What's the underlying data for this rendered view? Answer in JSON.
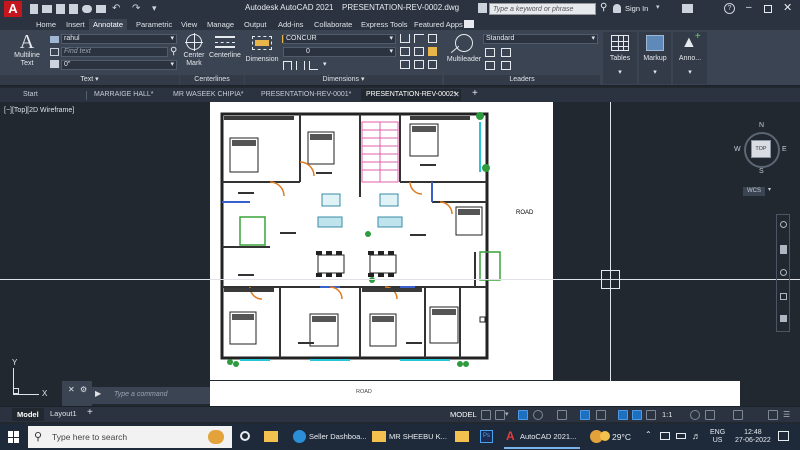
{
  "titlebar": {
    "app_title": "Autodesk AutoCAD 2021",
    "file_name": "PRESENTATION-REV-0002.dwg",
    "search_placeholder": "Type a keyword or phrase",
    "sign_in": "Sign In"
  },
  "ribbon_tabs": [
    "Home",
    "Insert",
    "Annotate",
    "Parametric",
    "View",
    "Manage",
    "Output",
    "Add-ins",
    "Collaborate",
    "Express Tools",
    "Featured Apps"
  ],
  "ribbon": {
    "multiline_text": "Multiline Text",
    "text_style": "rahul",
    "find_text_placeholder": "Find text",
    "text_height": "0\"",
    "panel_text": "Text",
    "center_mark": "Center Mark",
    "centerline": "Centerline",
    "panel_centerlines": "Centerlines",
    "dimension": "Dimension",
    "dim_style": "CONCUR",
    "dim_value": "0",
    "panel_dimensions": "Dimensions",
    "multileader": "Multileader",
    "leader_style": "Standard",
    "panel_leaders": "Leaders",
    "tables": "Tables",
    "markup": "Markup",
    "annotation": "Anno..."
  },
  "doc_tabs": [
    "Start",
    "MARRAIGE HALL*",
    "MR WASEEK CHIPIA*",
    "PRESENTATION-REV-0001*",
    "PRESENTATION-REV-0002*"
  ],
  "viewport": {
    "label": "[−][Top][2D Wireframe]",
    "road_right": "ROAD",
    "road_bottom": "ROAD",
    "viewcube_top": "TOP",
    "compass_n": "N",
    "compass_w": "W",
    "compass_e": "E",
    "compass_s": "S",
    "wcs": "WCS",
    "axis_y": "Y",
    "axis_x": "X"
  },
  "command": {
    "placeholder": "Type a command"
  },
  "layout_tabs": [
    "Model",
    "Layout1"
  ],
  "status": {
    "model": "MODEL",
    "scale": "1:1"
  },
  "taskbar": {
    "search_placeholder": "Type here to search",
    "items": [
      "Seller Dashboa...",
      "MR SHEEBU K...",
      "AutoCAD 2021..."
    ],
    "temperature": "29°C",
    "lang": "ENG",
    "region": "US",
    "time": "12:48",
    "date": "27-06-2022"
  },
  "colors": {
    "autocad_red": "#c4161c",
    "canvas_bg": "#212830",
    "drawing_bg": "#ffffff"
  }
}
